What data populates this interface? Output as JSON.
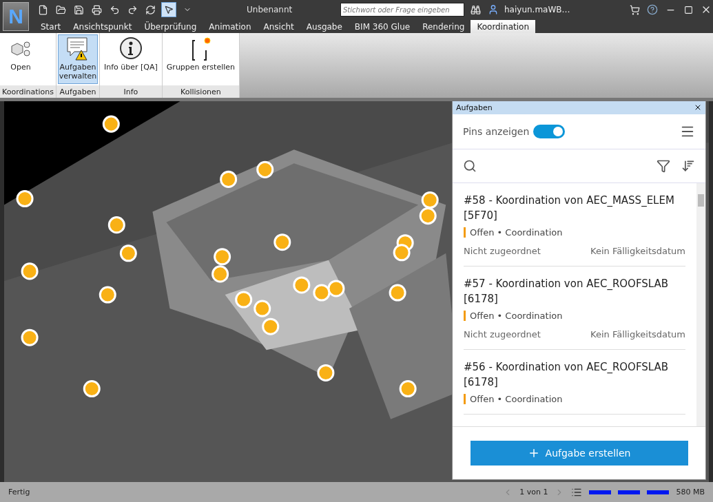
{
  "app": {
    "logo": "N",
    "title": "Unbenannt",
    "search": {
      "placeholder": "Stichwort oder Frage eingeben"
    },
    "user": "haiyun.maWB…"
  },
  "menu_tabs": [
    {
      "label": "Start",
      "selected": false
    },
    {
      "label": "Ansichtspunkt",
      "selected": false
    },
    {
      "label": "Überprüfung",
      "selected": false
    },
    {
      "label": "Animation",
      "selected": false
    },
    {
      "label": "Ansicht",
      "selected": false
    },
    {
      "label": "Ausgabe",
      "selected": false
    },
    {
      "label": "BIM 360 Glue",
      "selected": false
    },
    {
      "label": "Rendering",
      "selected": false
    },
    {
      "label": "Koordination",
      "selected": true
    }
  ],
  "ribbon": {
    "groups": [
      {
        "label": "Koordinations",
        "buttons": [
          {
            "label": "Open",
            "kind": "open",
            "selected": false
          }
        ]
      },
      {
        "label": "Aufgaben",
        "buttons": [
          {
            "label": "Aufgaben verwalten",
            "kind": "tasks",
            "selected": true
          }
        ]
      },
      {
        "label": "Info",
        "buttons": [
          {
            "label": "Info über [QA]",
            "kind": "info",
            "selected": false
          }
        ]
      },
      {
        "label": "Kollisionen",
        "buttons": [
          {
            "label": "Gruppen erstellen",
            "kind": "groups",
            "selected": false
          }
        ]
      }
    ]
  },
  "tasks_panel": {
    "title": "Aufgaben",
    "pins_label": "Pins anzeigen",
    "pins_on": true,
    "tasks": [
      {
        "title": "#58 - Koordination von AEC_MASS_ELEM [5F70]",
        "status": "Offen • Coordination",
        "assignee": "Nicht zugeordnet",
        "due": "Kein Fälligkeitsdatum"
      },
      {
        "title": "#57 - Koordination von AEC_ROOFSLAB [6178]",
        "status": "Offen • Coordination",
        "assignee": "Nicht zugeordnet",
        "due": "Kein Fälligkeitsdatum"
      },
      {
        "title": "#56 - Koordination von AEC_ROOFSLAB [6178]",
        "status": "Offen • Coordination"
      }
    ],
    "create_button": "Aufgabe erstellen"
  },
  "status_bar": {
    "text": "Fertig",
    "page": "1 von 1",
    "memory": "580 MB"
  }
}
